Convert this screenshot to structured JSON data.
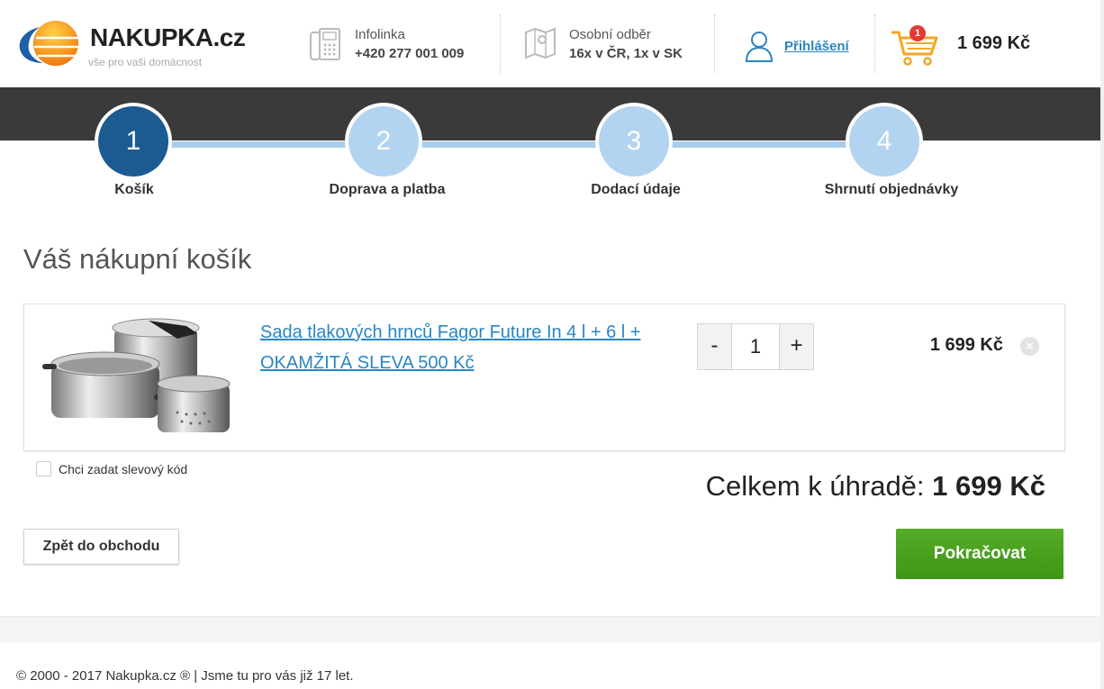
{
  "header": {
    "logo": {
      "brand": "NAKUPKA.cz",
      "tagline": "vše pro vaši domácnost"
    },
    "infolinka": {
      "label": "Infolinka",
      "value": "+420 277 001 009",
      "icon": "phone-icon"
    },
    "pickup": {
      "label": "Osobní odběr",
      "value": "16x v ČR, 1x v SK",
      "icon": "map-icon"
    },
    "login": {
      "label": "Přihlášení",
      "icon": "user-icon"
    },
    "cart": {
      "count": "1",
      "total": "1 699 Kč",
      "icon": "cart-icon"
    }
  },
  "steps": [
    {
      "number": "1",
      "label": "Košík",
      "active": true
    },
    {
      "number": "2",
      "label": "Doprava a platba",
      "active": false
    },
    {
      "number": "3",
      "label": "Dodací údaje",
      "active": false
    },
    {
      "number": "4",
      "label": "Shrnutí objednávky",
      "active": false
    }
  ],
  "page_title": "Váš nákupní košík",
  "cart_item": {
    "name": "Sada tlakových hrnců Fagor Future In 4 l + 6 l + OKAMŽITÁ SLEVA 500 Kč",
    "quantity": "1",
    "minus": "-",
    "plus": "+",
    "price": "1 699 Kč",
    "remove": "×"
  },
  "discount": {
    "label": "Chci zadat slevový kód"
  },
  "total": {
    "label": "Celkem k úhradě:",
    "value": "1 699 Kč"
  },
  "buttons": {
    "back": "Zpět do obchodu",
    "continue": "Pokračovat"
  },
  "footer": {
    "text": "© 2000 - 2017 Nakupka.cz ® | Jsme tu pro vás již 17 let."
  },
  "colors": {
    "accent": "#2a86c2",
    "step_active": "#1c5a92",
    "step_inactive": "#b3d4f0",
    "continue": "#4aa11f",
    "badge": "#e23b35"
  }
}
